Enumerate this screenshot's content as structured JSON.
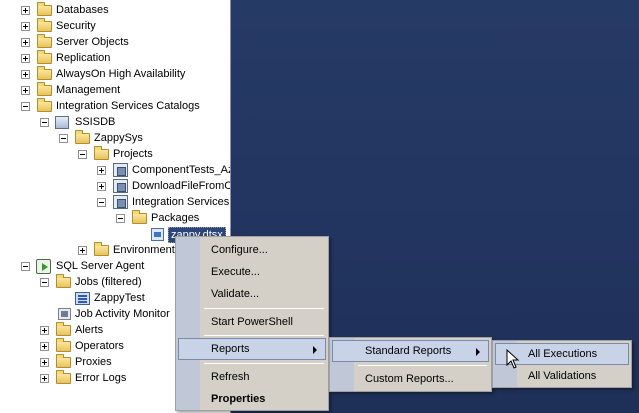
{
  "tree": {
    "items": [
      {
        "label": "Databases",
        "expander": "plus",
        "icon": "folder-icon"
      },
      {
        "label": "Security",
        "expander": "plus",
        "icon": "folder-icon"
      },
      {
        "label": "Server Objects",
        "expander": "plus",
        "icon": "folder-icon"
      },
      {
        "label": "Replication",
        "expander": "plus",
        "icon": "folder-icon"
      },
      {
        "label": "AlwaysOn High Availability",
        "expander": "plus",
        "icon": "folder-icon"
      },
      {
        "label": "Management",
        "expander": "plus",
        "icon": "folder-icon"
      },
      {
        "label": "Integration Services Catalogs",
        "expander": "minus",
        "icon": "folder-icon"
      },
      {
        "label": "SSISDB",
        "expander": "minus",
        "icon": "database-icon"
      },
      {
        "label": "ZappySys",
        "expander": "minus",
        "icon": "folder-icon"
      },
      {
        "label": "Projects",
        "expander": "minus",
        "icon": "folder-icon"
      },
      {
        "label": "ComponentTests_Az",
        "expander": "plus",
        "icon": "project-icon"
      },
      {
        "label": "DownloadFileFromCl",
        "expander": "plus",
        "icon": "project-icon"
      },
      {
        "label": "Integration Services",
        "expander": "minus",
        "icon": "project-icon"
      },
      {
        "label": "Packages",
        "expander": "minus",
        "icon": "folder-icon"
      },
      {
        "label": "zappy.dtsx",
        "expander": "none",
        "icon": "package-icon",
        "selected": true
      },
      {
        "label": "Environments",
        "expander": "plus",
        "icon": "folder-icon"
      },
      {
        "label": "SQL Server Agent",
        "expander": "minus",
        "icon": "agent-icon"
      },
      {
        "label": "Jobs (filtered)",
        "expander": "minus",
        "icon": "folder-icon"
      },
      {
        "label": "ZappyTest",
        "expander": "none",
        "icon": "job-icon"
      },
      {
        "label": "Job Activity Monitor",
        "expander": "none",
        "icon": "monitor-icon"
      },
      {
        "label": "Alerts",
        "expander": "plus",
        "icon": "folder-icon"
      },
      {
        "label": "Operators",
        "expander": "plus",
        "icon": "folder-icon"
      },
      {
        "label": "Proxies",
        "expander": "plus",
        "icon": "folder-icon"
      },
      {
        "label": "Error Logs",
        "expander": "plus",
        "icon": "folder-icon"
      }
    ]
  },
  "context_menu": {
    "configure": "Configure...",
    "execute": "Execute...",
    "validate": "Validate...",
    "start_powershell": "Start PowerShell",
    "reports": "Reports",
    "refresh": "Refresh",
    "properties": "Properties"
  },
  "reports_submenu": {
    "standard_reports": "Standard Reports",
    "custom_reports": "Custom Reports..."
  },
  "standard_reports_submenu": {
    "all_executions": "All Executions",
    "all_validations": "All Validations"
  },
  "colors": {
    "workspace_background": "#233661",
    "menu_background": "#d4d0c8",
    "menu_highlight": "#c9d3e8",
    "selection": "#2c4679"
  }
}
